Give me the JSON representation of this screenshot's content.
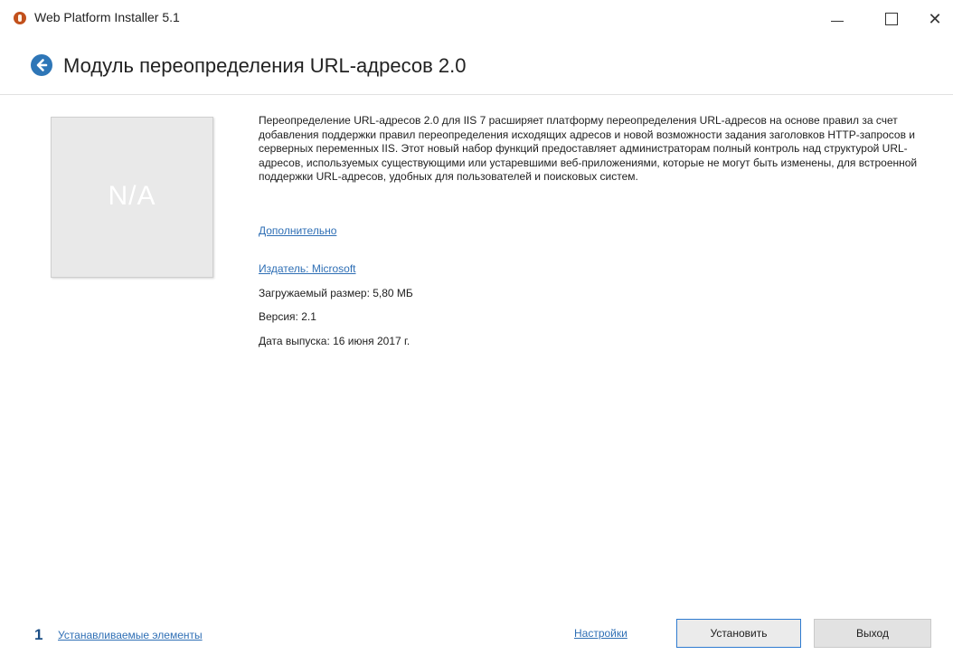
{
  "window": {
    "title": "Web Platform Installer 5.1"
  },
  "header": {
    "title": "Модуль переопределения URL-адресов 2.0"
  },
  "product": {
    "thumbnail_text": "N/A",
    "description": "Переопределение URL-адресов 2.0 для IIS 7 расширяет платформу переопределения URL-адресов на основе правил за счет добавления поддержки правил переопределения исходящих адресов и новой возможности задания заголовков HTTP-запросов и серверных переменных IIS. Этот новый набор функций предоставляет администраторам полный контроль над структурой URL-адресов, используемых существующими или устаревшими веб-приложениями, которые не могут быть изменены, для встроенной поддержки URL-адресов, удобных для пользователей и поисковых систем.",
    "more_link": "Дополнительно",
    "publisher_link": "Издатель: Microsoft",
    "download_size": "Загружаемый размер: 5,80 МБ",
    "version": "Версия: 2.1",
    "release_date": "Дата выпуска: 16 июня 2017 г."
  },
  "footer": {
    "count": "1",
    "install_items_link": "Устанавливаемые элементы",
    "settings_link": "Настройки",
    "install_button": "Установить",
    "exit_button": "Выход"
  },
  "colors": {
    "accent": "#2e76b7",
    "link": "#2f6fb5",
    "count": "#1c4f86"
  }
}
